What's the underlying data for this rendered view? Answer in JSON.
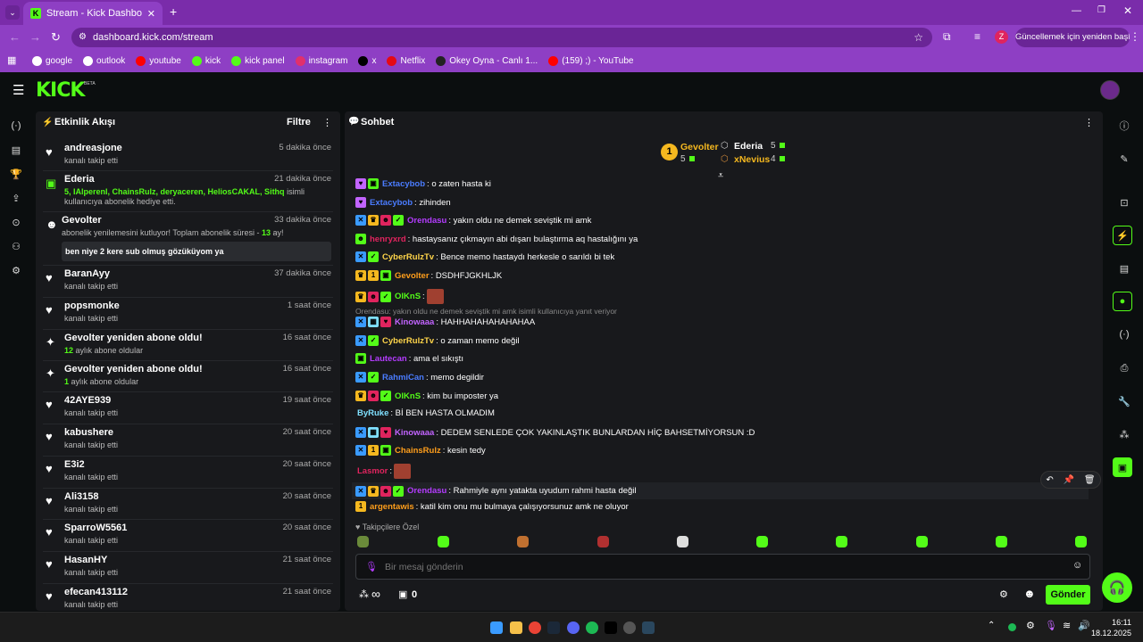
{
  "browser": {
    "tab_title": "Stream - Kick Dashboard",
    "url": "dashboard.kick.com/stream",
    "update_button": "Güncellemek için yeniden başlat",
    "profile_initial": "Z",
    "bookmarks": [
      {
        "label": "google",
        "color": "#ffffff"
      },
      {
        "label": "outlook",
        "color": "#ffffff"
      },
      {
        "label": "youtube",
        "color": "#ff0000"
      },
      {
        "label": "kick",
        "color": "#53fc18"
      },
      {
        "label": "kick panel",
        "color": "#53fc18"
      },
      {
        "label": "instagram",
        "color": "#e1306c"
      },
      {
        "label": "x",
        "color": "#000000"
      },
      {
        "label": "Netflix",
        "color": "#e50914"
      },
      {
        "label": "Okey Oyna - Canlı 1...",
        "color": "#222222"
      },
      {
        "label": "(159) ;) - YouTube",
        "color": "#ff0000"
      }
    ]
  },
  "kick": {
    "logo": "KICK",
    "beta": "BETA"
  },
  "activity": {
    "title": "Etkinlik Akışı",
    "filter": "Filtre",
    "items": [
      {
        "name": "andreasjone",
        "time": "5 dakika önce",
        "sub": "kanalı takip etti"
      },
      {
        "name": "Ederia",
        "time": "21 dakika önce",
        "sub_gift_names": "5, IAlperenI, ChainsRulz, deryaceren, HeliosCAKAL, Sithq",
        "sub_gift_tail": " isimli kullanıcıya abonelik hediye etti."
      },
      {
        "name": "Gevolter",
        "time": "33 dakika önce",
        "sub_pre": "abonelik yenilemesini kutluyor! Toplam abonelik süresi - ",
        "sub_num": "13",
        "sub_post": " ay!",
        "message": "ben niye 2 kere sub olmuş gözüküyom ya"
      },
      {
        "name": "BaranAyy",
        "time": "37 dakika önce",
        "sub": "kanalı takip etti"
      },
      {
        "name": "popsmonke",
        "time": "1 saat önce",
        "sub": "kanalı takip etti"
      },
      {
        "name": "Gevolter yeniden abone oldu!",
        "time": "16 saat önce",
        "sub_num": "12",
        "sub": " aylık abone oldular"
      },
      {
        "name": "Gevolter yeniden abone oldu!",
        "time": "16 saat önce",
        "sub_num": "1",
        "sub": " aylık abone oldular"
      },
      {
        "name": "42AYE939",
        "time": "19 saat önce",
        "sub": "kanalı takip etti"
      },
      {
        "name": "kabushere",
        "time": "20 saat önce",
        "sub": "kanalı takip etti"
      },
      {
        "name": "E3i2",
        "time": "20 saat önce",
        "sub": "kanalı takip etti"
      },
      {
        "name": "Ali3158",
        "time": "20 saat önce",
        "sub": "kanalı takip etti"
      },
      {
        "name": "SparroW5561",
        "time": "20 saat önce",
        "sub": "kanalı takip etti"
      },
      {
        "name": "HasanHY",
        "time": "21 saat önce",
        "sub": "kanalı takip etti"
      },
      {
        "name": "efecan413112",
        "time": "21 saat önce",
        "sub": "kanalı takip etti"
      }
    ]
  },
  "chat": {
    "title": "Sohbet",
    "leaderboard": {
      "first": {
        "rank": "1",
        "name": "Gevolter",
        "count": "5"
      },
      "second": {
        "name": "Ederia",
        "count": "5"
      },
      "third": {
        "name": "xNevius",
        "count": "4"
      }
    },
    "messages": [
      {
        "user": "Extacybob",
        "color": "#4a7cff",
        "text": ": o zaten hasta ki"
      },
      {
        "user": "Extacybob",
        "color": "#4a7cff",
        "text": ": zihinden"
      },
      {
        "user": "Orendasu",
        "color": "#b43cff",
        "text": ": yakın oldu ne demek seviştik mi amk"
      },
      {
        "user": "henryxrd",
        "color": "#e0245e",
        "text": ": hastaysanız çıkmayın abi dışarı bulaştırma aq hastalığını ya"
      },
      {
        "user": "CyberRulzTv",
        "color": "#ffd54a",
        "text": ": Bence memo hastaydı herkesle o sarıldı bi tek"
      },
      {
        "user": "Gevolter",
        "color": "#ff9e1b",
        "text": ": DSDHFJGKHLJK"
      },
      {
        "user": "OlKnS",
        "color": "#53fc18",
        "text": ":"
      },
      {
        "user": "Kinowaaa",
        "color": "#c264ff",
        "text": ": HAHHAHAHAHAHAHAA"
      },
      {
        "user": "CyberRulzTv",
        "color": "#ffd54a",
        "text": ": o zaman memo değil"
      },
      {
        "user": "Lautecan",
        "color": "#b43cff",
        "text": ": ama el sıkıştı"
      },
      {
        "user": "RahmiCan",
        "color": "#4a7cff",
        "text": ": memo degildir"
      },
      {
        "user": "OlKnS",
        "color": "#53fc18",
        "text": ": kim bu imposter ya"
      },
      {
        "user": "ByRuke",
        "color": "#7fe0ff",
        "text": ": Bİ BEN HASTA OLMADIM"
      },
      {
        "user": "Kinowaaa",
        "color": "#c264ff",
        "text": ": DEDEM SENLEDE ÇOK YAKINLAŞTIK BUNLARDAN HİÇ BAHSETMİYORSUN :D"
      },
      {
        "user": "ChainsRulz",
        "color": "#ff9e1b",
        "text": ": kesin tedy"
      },
      {
        "user": "Lasmor",
        "color": "#e0245e",
        "text": ":"
      },
      {
        "user": "Orendasu",
        "color": "#b43cff",
        "text": ": Rahmiyle aynı yatakta uyudum rahmi hasta değil"
      },
      {
        "user": "argentawis",
        "color": "#ff9e1b",
        "text": ": katil kim onu mu bulmaya çalışıyorsunuz amk ne oluyor"
      }
    ],
    "reply_note": "Orendasu: yakın oldu ne demek seviştik mi amk isimli kullanıcıya yanıt veriyor",
    "followers_only": "Takipçilere Özel",
    "placeholder": "Bir mesaj gönderin",
    "infinity": "∞",
    "store_count": "0",
    "send": "Gönder"
  },
  "taskbar": {
    "time": "16:11",
    "date": "18.12.2025"
  }
}
